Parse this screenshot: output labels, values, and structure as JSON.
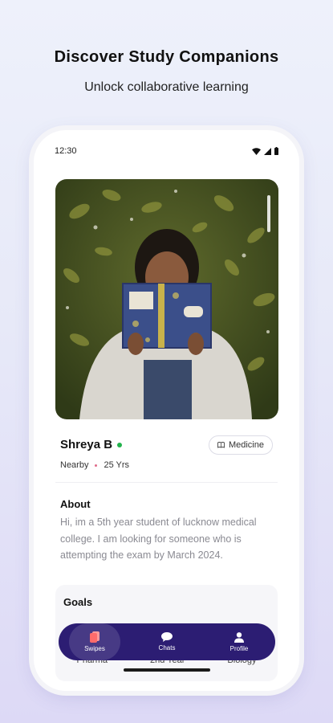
{
  "promo": {
    "headline": "Discover Study Companions",
    "subline": "Unlock collaborative learning"
  },
  "status_bar": {
    "time": "12:30",
    "icons": [
      "wifi-icon",
      "signal-icon",
      "battery-icon"
    ]
  },
  "profile": {
    "name": "Shreya B",
    "online": true,
    "subject_tag": "Medicine",
    "distance": "Nearby",
    "age": "25 Yrs",
    "about_title": "About",
    "about_text": "Hi, im a 5th year student of lucknow medical college. I am looking for someone who is attempting the exam by March 2024.",
    "goals_title": "Goals",
    "goals": [
      "Pharma",
      "2nd Year",
      "Biology"
    ]
  },
  "bottom_nav": {
    "items": [
      {
        "label": "Swipes",
        "icon": "cards-icon",
        "active": true
      },
      {
        "label": "Chats",
        "icon": "chat-bubble-icon",
        "active": false
      },
      {
        "label": "Profile",
        "icon": "person-icon",
        "active": false
      }
    ]
  },
  "colors": {
    "nav_bg": "#2c1d73",
    "accent_swipes": "#ff6b6b",
    "online": "#22b24c",
    "background_top": "#eef1fb",
    "background_bottom": "#ddd9f6"
  }
}
